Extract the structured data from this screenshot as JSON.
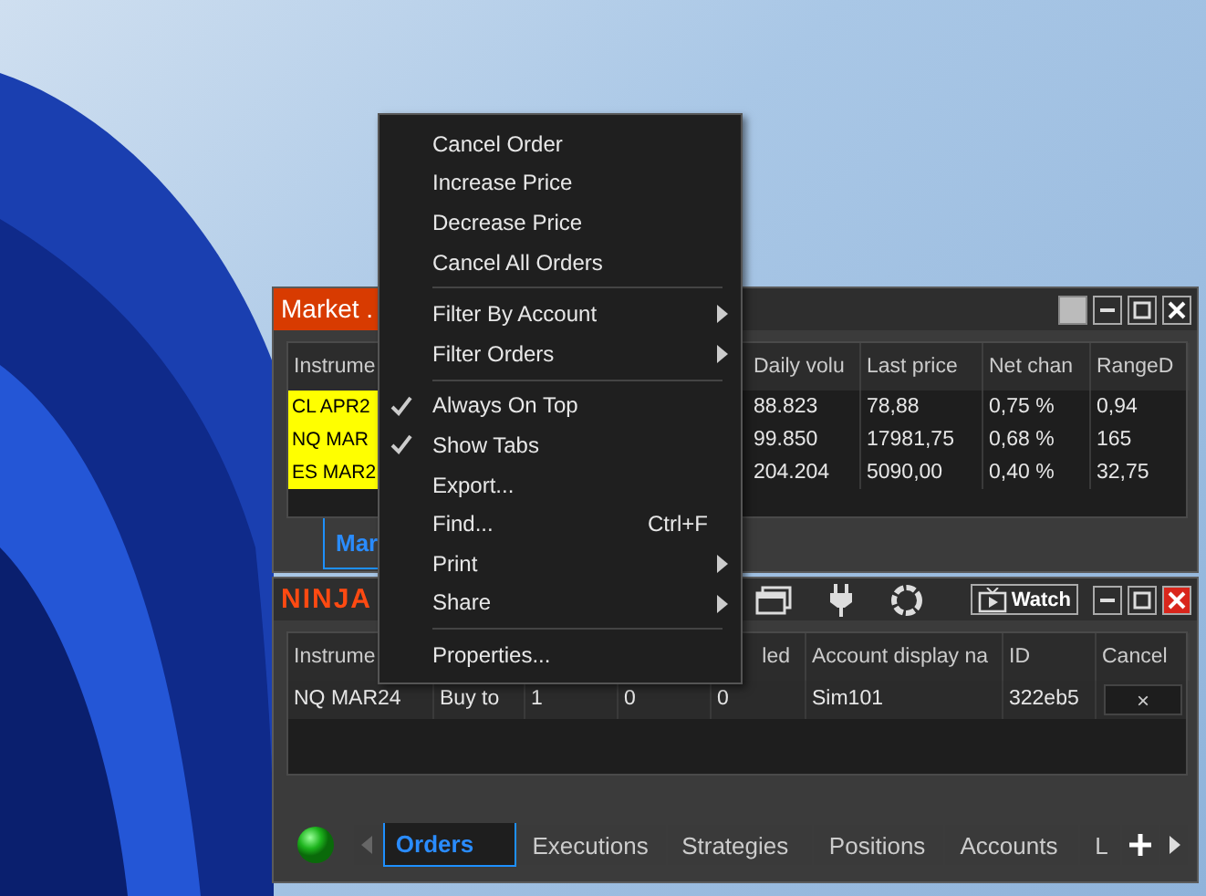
{
  "market_window": {
    "title": "Market .",
    "columns": [
      "Instrume",
      "Daily volu",
      "Last price",
      "Net chan",
      "RangeD"
    ],
    "rows": [
      {
        "cells": [
          "CL APR2",
          "88.823",
          "78,88",
          "0,75 %",
          "0,94"
        ]
      },
      {
        "cells": [
          "NQ MAR",
          "99.850",
          "17981,75",
          "0,68 %",
          "165"
        ]
      },
      {
        "cells": [
          "ES MAR2",
          "204.204",
          "5090,00",
          "0,40 %",
          "32,75"
        ]
      }
    ],
    "tabs": [
      {
        "label": "Mar",
        "selected": true
      }
    ]
  },
  "control_center": {
    "title": "NINJA",
    "watch_button": "Watch",
    "columns": [
      "Instrume",
      "",
      "",
      "",
      "led",
      "Account display na",
      "ID",
      "Cancel"
    ],
    "rows": [
      {
        "cells": [
          "NQ MAR24",
          "Buy to",
          "1",
          "0",
          "0",
          "Sim101",
          "322eb5"
        ],
        "cancel": "×"
      }
    ],
    "tabs": [
      {
        "label": "Orders",
        "selected": true
      },
      {
        "label": "Executions",
        "selected": false
      },
      {
        "label": "Strategies",
        "selected": false
      },
      {
        "label": "Positions",
        "selected": false
      },
      {
        "label": "Accounts",
        "selected": false
      },
      {
        "label": "L",
        "selected": false
      }
    ]
  },
  "context_menu": {
    "items": [
      {
        "kind": "item",
        "label": "Cancel Order",
        "checked": false,
        "submenu": false
      },
      {
        "kind": "item",
        "label": "Increase Price",
        "checked": false,
        "submenu": false
      },
      {
        "kind": "item",
        "label": "Decrease Price",
        "checked": false,
        "submenu": false
      },
      {
        "kind": "item",
        "label": "Cancel All Orders",
        "checked": false,
        "submenu": false
      },
      {
        "kind": "separator"
      },
      {
        "kind": "item",
        "label": "Filter By Account",
        "checked": false,
        "submenu": true
      },
      {
        "kind": "item",
        "label": "Filter Orders",
        "checked": false,
        "submenu": true
      },
      {
        "kind": "separator"
      },
      {
        "kind": "item",
        "label": "Always On Top",
        "checked": true,
        "submenu": false
      },
      {
        "kind": "item",
        "label": "Show Tabs",
        "checked": true,
        "submenu": false
      },
      {
        "kind": "item",
        "label": "Export...",
        "checked": false,
        "submenu": false
      },
      {
        "kind": "item",
        "label": "Find...",
        "shortcut": "Ctrl+F",
        "checked": false,
        "submenu": false
      },
      {
        "kind": "item",
        "label": "Print",
        "checked": false,
        "submenu": true
      },
      {
        "kind": "item",
        "label": "Share",
        "checked": false,
        "submenu": true
      },
      {
        "kind": "separator"
      },
      {
        "kind": "item",
        "label": "Properties...",
        "checked": false,
        "submenu": false
      }
    ]
  }
}
